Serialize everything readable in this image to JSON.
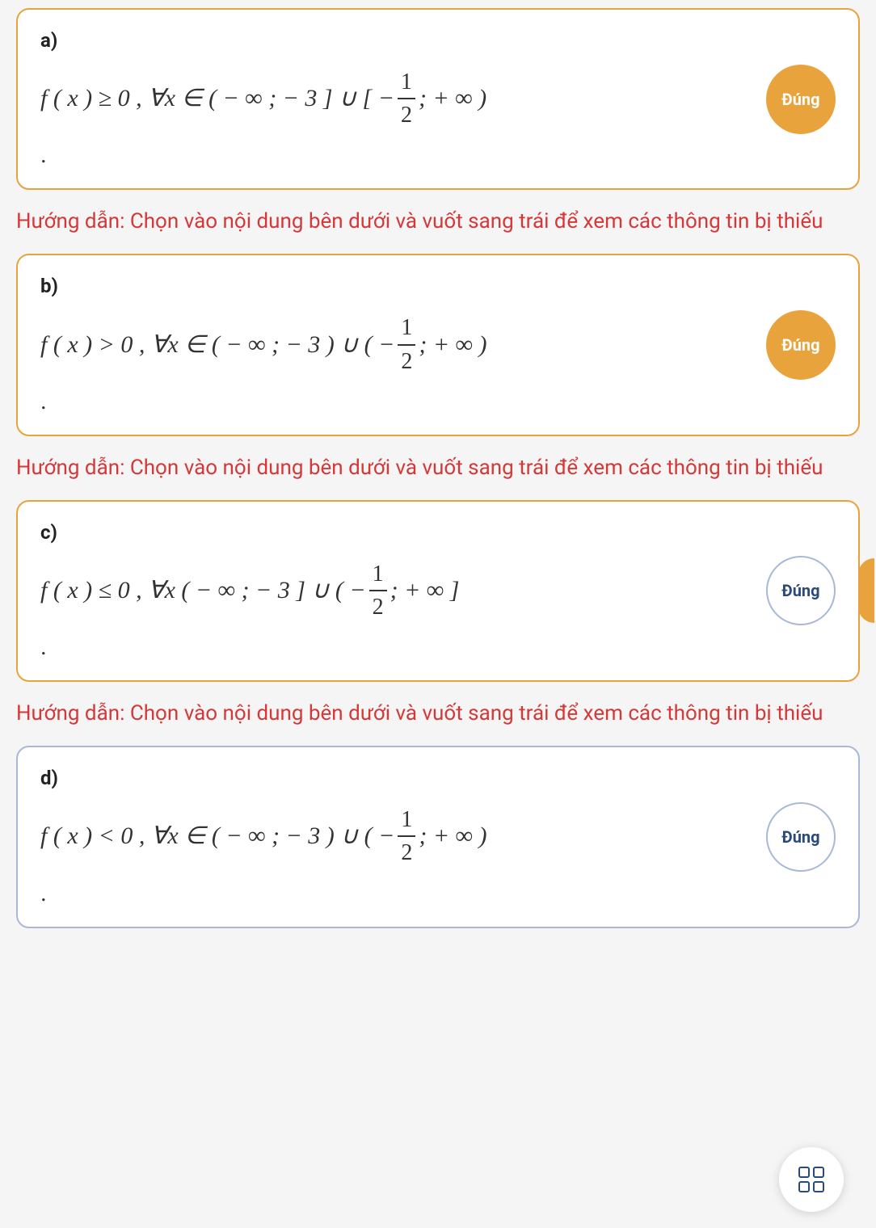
{
  "questions": [
    {
      "label": "a)",
      "math_prefix": "f ( x ) ≥ 0 , ∀x ∈ ( − ∞ ; − 3 ] ∪ [ − ",
      "frac_num": "1",
      "frac_den": "2",
      "math_suffix": " ; + ∞ )",
      "badge": "Đúng",
      "badge_style": "filled",
      "box_style": "orange",
      "show_edge": false
    },
    {
      "label": "b)",
      "math_prefix": "f ( x ) > 0 , ∀x ∈ ( − ∞ ; − 3 ) ∪ ( − ",
      "frac_num": "1",
      "frac_den": "2",
      "math_suffix": " ; + ∞ )",
      "badge": "Đúng",
      "badge_style": "filled",
      "box_style": "orange",
      "show_edge": false
    },
    {
      "label": "c)",
      "math_prefix": "f ( x ) ≤ 0 , ∀x ( − ∞ ; − 3 ] ∪ ( − ",
      "frac_num": "1",
      "frac_den": "2",
      "math_suffix": " ; + ∞ ]",
      "badge": "Đúng",
      "badge_style": "outlined",
      "box_style": "orange",
      "show_edge": true
    },
    {
      "label": "d)",
      "math_prefix": "f ( x ) < 0 , ∀x ∈ ( − ∞ ; − 3 ) ∪ ( − ",
      "frac_num": "1",
      "frac_den": "2",
      "math_suffix": " ; + ∞ )",
      "badge": "Đúng",
      "badge_style": "outlined",
      "box_style": "blue",
      "show_edge": false
    }
  ],
  "hint_text": "Hướng dẫn: Chọn vào nội dung bên dưới và vuốt sang trái để xem các thông tin bị thiếu"
}
